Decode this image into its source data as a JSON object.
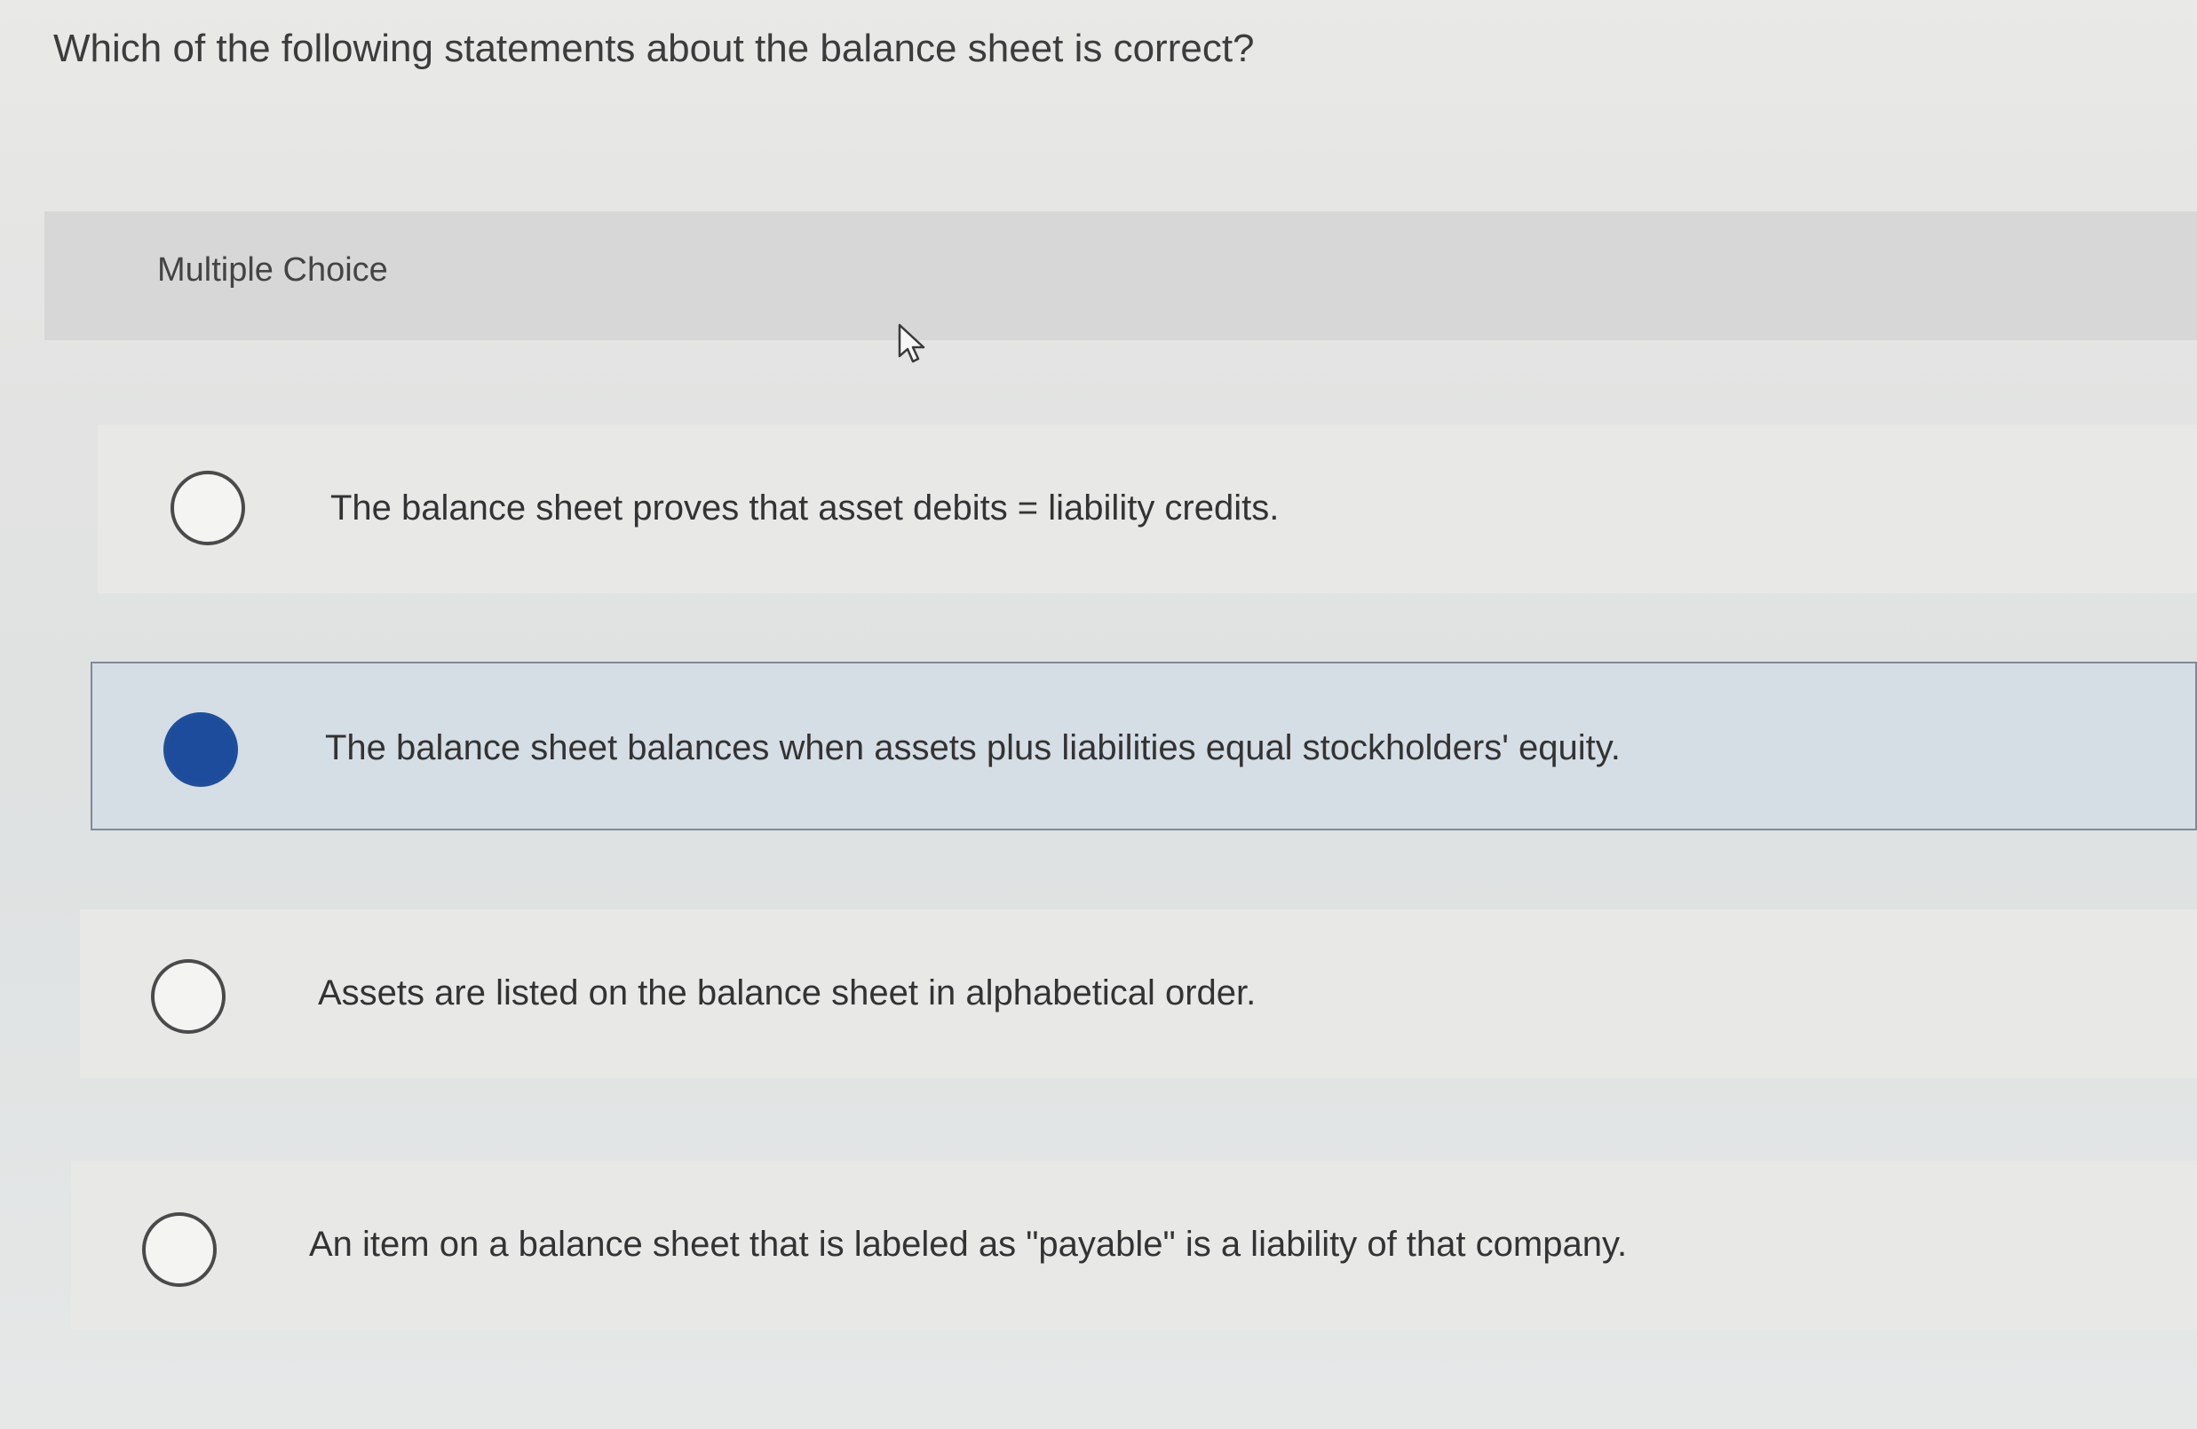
{
  "question": "Which of the following statements about the balance sheet is correct?",
  "section_label": "Multiple Choice",
  "options": [
    {
      "text": "The balance sheet proves that asset debits = liability credits.",
      "selected": false
    },
    {
      "text": "The balance sheet balances when assets plus liabilities equal stockholders' equity.",
      "selected": true
    },
    {
      "text": "Assets are listed on the balance sheet in alphabetical order.",
      "selected": false
    },
    {
      "text": "An item on a balance sheet that is labeled as \"payable\" is a liability of that company.",
      "selected": false
    }
  ],
  "colors": {
    "selected_radio": "#1d4c9c",
    "selected_background": "#d5dde5"
  },
  "icons": [
    "mouse-pointer-icon"
  ]
}
